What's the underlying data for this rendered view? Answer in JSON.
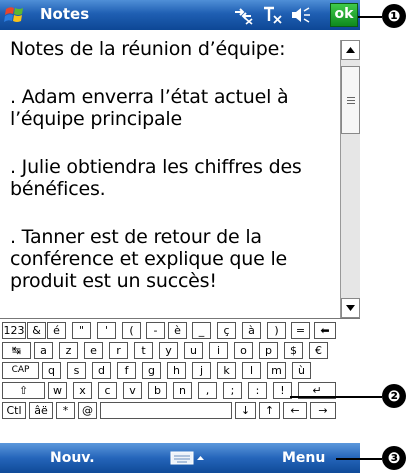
{
  "titlebar": {
    "app_title": "Notes",
    "ok_label": "ok",
    "icons": [
      "windows-start-icon",
      "connectivity-icon",
      "signal-icon",
      "volume-icon"
    ]
  },
  "note": {
    "paragraphs": [
      "Notes de la réunion d’équipe:",
      ". Adam enverra l’état actuel à l’équipe principale",
      ". Julie obtiendra les chiffres des bénéfices.",
      ". Tanner est de retour de la conférence et explique que le produit est un succès!"
    ]
  },
  "keyboard": {
    "rows": [
      [
        "123",
        "&",
        "é",
        "\"",
        "'",
        "(",
        "-",
        "è",
        "_",
        "ç",
        "à",
        ")",
        "=",
        "⬅"
      ],
      [
        "↹",
        "a",
        "z",
        "e",
        "r",
        "t",
        "y",
        "u",
        "i",
        "o",
        "p",
        "$",
        "€"
      ],
      [
        "CAP",
        "q",
        "s",
        "d",
        "f",
        "g",
        "h",
        "j",
        "k",
        "l",
        "m",
        "ù"
      ],
      [
        "⇧",
        "w",
        "x",
        "c",
        "v",
        "b",
        "n",
        ",",
        ";",
        ":",
        "!",
        "↵"
      ],
      [
        "Ctl",
        "âë",
        "*",
        "@",
        "",
        "↓",
        "↑",
        "←",
        "→"
      ]
    ]
  },
  "bottombar": {
    "left_softkey": "Nouv.",
    "right_softkey": "Menu"
  },
  "callouts": [
    "❶",
    "❷",
    "❸"
  ],
  "colors": {
    "titlebar": "#1f5fb3",
    "ok": "#1a9a2a",
    "text": "#000000"
  }
}
